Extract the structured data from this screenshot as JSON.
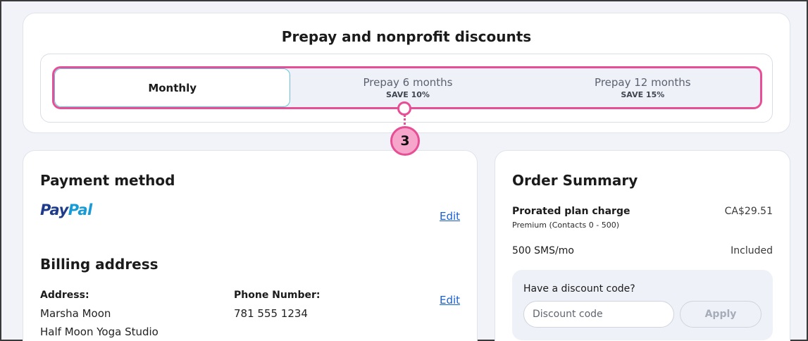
{
  "discounts": {
    "title": "Prepay and nonprofit discounts",
    "options": [
      {
        "label": "Monthly",
        "save": "",
        "selected": true
      },
      {
        "label": "Prepay 6 months",
        "save": "SAVE 10%",
        "selected": false
      },
      {
        "label": "Prepay 12 months",
        "save": "SAVE 15%",
        "selected": false
      }
    ],
    "callout_number": "3"
  },
  "payment": {
    "title": "Payment method",
    "paypal_pay": "Pay",
    "paypal_pal": "Pal",
    "edit_label": "Edit"
  },
  "billing": {
    "title": "Billing address",
    "address_label": "Address:",
    "address_lines": [
      "Marsha Moon",
      "Half Moon Yoga Studio"
    ],
    "phone_label": "Phone Number:",
    "phone_value": "781 555 1234",
    "edit_label": "Edit"
  },
  "summary": {
    "title": "Order Summary",
    "plan_charge_label": "Prorated plan charge",
    "plan_charge_sub": "Premium (Contacts 0 - 500)",
    "plan_charge_amount": "CA$29.51",
    "sms_label": "500 SMS/mo",
    "sms_amount": "Included",
    "discount_prompt": "Have a discount code?",
    "discount_placeholder": "Discount code",
    "apply_label": "Apply"
  },
  "colors": {
    "highlight": "#e74e95",
    "link": "#1a5fd0",
    "paypal_dark": "#1e3a8a",
    "paypal_light": "#169bd7"
  }
}
